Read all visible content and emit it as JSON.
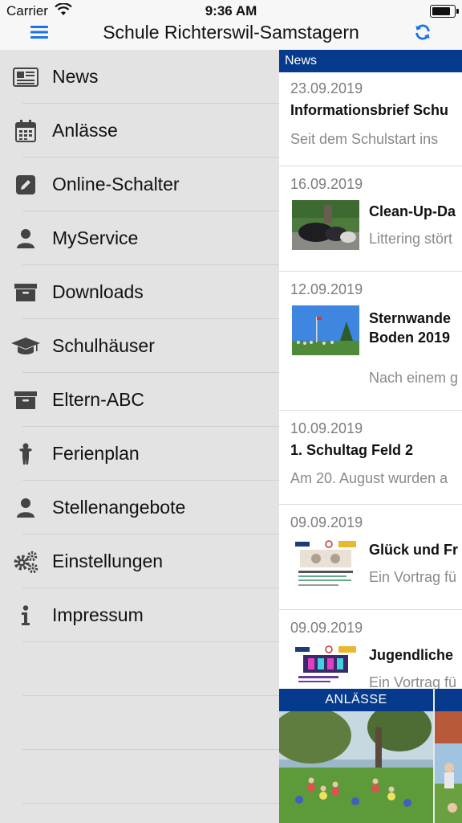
{
  "status_bar": {
    "carrier": "Carrier",
    "time": "9:36 AM"
  },
  "nav": {
    "title": "Schule Richterswil-Samstagern",
    "menu_icon": "hamburger-icon",
    "refresh_icon": "refresh-icon"
  },
  "menu": {
    "items": [
      {
        "label": "News",
        "icon": "newspaper-icon"
      },
      {
        "label": "Anlässe",
        "icon": "calendar-icon"
      },
      {
        "label": "Online-Schalter",
        "icon": "pencil-square-icon"
      },
      {
        "label": "MyService",
        "icon": "user-icon"
      },
      {
        "label": "Downloads",
        "icon": "archive-icon"
      },
      {
        "label": "Schulhäuser",
        "icon": "graduation-cap-icon"
      },
      {
        "label": "Eltern-ABC",
        "icon": "archive-icon"
      },
      {
        "label": "Ferienplan",
        "icon": "child-icon"
      },
      {
        "label": "Stellenangebote",
        "icon": "user-icon"
      },
      {
        "label": "Einstellungen",
        "icon": "gears-icon"
      },
      {
        "label": "Impressum",
        "icon": "info-icon"
      }
    ]
  },
  "news": {
    "header": "News",
    "items": [
      {
        "date": "23.09.2019",
        "title": "Informationsbrief Schu",
        "subtitle": "Seit dem Schulstart ins"
      },
      {
        "date": "16.09.2019",
        "title": "Clean-Up-Da",
        "subtitle": "Littering stört"
      },
      {
        "date": "12.09.2019",
        "title": "Sternwande\nBoden 2019",
        "subtitle": "Nach einem g"
      },
      {
        "date": "10.09.2019",
        "title": "1. Schultag Feld 2",
        "subtitle": "Am 20. August wurden a"
      },
      {
        "date": "09.09.2019",
        "title": "Glück und Fr",
        "subtitle": "Ein Vortrag fü"
      },
      {
        "date": "09.09.2019",
        "title": "Jugendliche",
        "subtitle": "Ein Vortrag fü"
      }
    ]
  },
  "events": {
    "header": "ANLÄSSE"
  },
  "colors": {
    "accent": "#063a8c",
    "icon_blue": "#1a73e8",
    "menu_bg": "#e3e3e3"
  }
}
